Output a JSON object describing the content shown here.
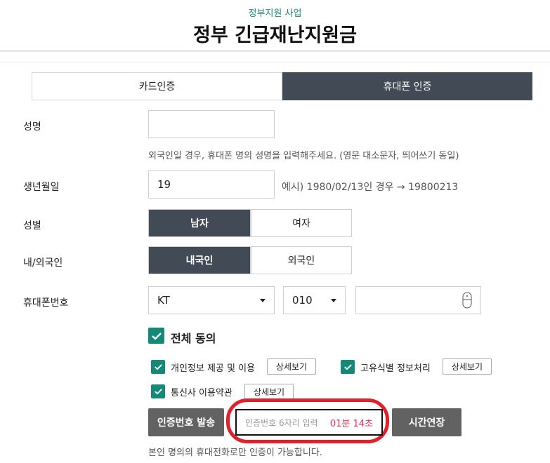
{
  "header": {
    "subtitle": "정부지원 사업",
    "title": "정부 긴급재난지원금"
  },
  "tabs": [
    {
      "label": "카드인증",
      "active": false
    },
    {
      "label": "휴대폰 인증",
      "active": true
    }
  ],
  "form": {
    "name": {
      "label": "성명",
      "value": "",
      "hint": "외국인일 경우, 휴대폰 명의 성명을 입력해주세요. (영문 대소문자, 띄어쓰기 동일)"
    },
    "birth": {
      "label": "생년월일",
      "value": "19",
      "hint": "예시) 1980/02/13인 경우 → 19800213"
    },
    "gender": {
      "label": "성별",
      "options": [
        "남자",
        "여자"
      ],
      "selected": "남자"
    },
    "nationality": {
      "label": "내/외국인",
      "options": [
        "내국인",
        "외국인"
      ],
      "selected": "내국인"
    },
    "phone": {
      "label": "휴대폰번호",
      "carrier": "KT",
      "prefix": "010",
      "number": "",
      "number_icon": "mouse-icon"
    },
    "agree_all": {
      "label": "전체 동의",
      "checked": true
    },
    "agreements": [
      {
        "label": "개인정보 제공 및 이용",
        "checked": true,
        "detail": "상세보기"
      },
      {
        "label": "고유식별 정보처리",
        "checked": true,
        "detail": "상세보기"
      },
      {
        "label": "통신사 이용약관",
        "checked": true,
        "detail": "상세보기"
      }
    ],
    "send_button": "인증번호 발송",
    "code": {
      "placeholder": "인증번호 6자리 입력",
      "timer": "01분 14초"
    },
    "extend_button": "시간연장",
    "note": "본인 명의의 휴대전화로만 인증이 가능합니다."
  },
  "colors": {
    "accent": "#138a78",
    "dark": "#424a55",
    "timer": "#e0305a",
    "highlight": "#e0202a"
  }
}
